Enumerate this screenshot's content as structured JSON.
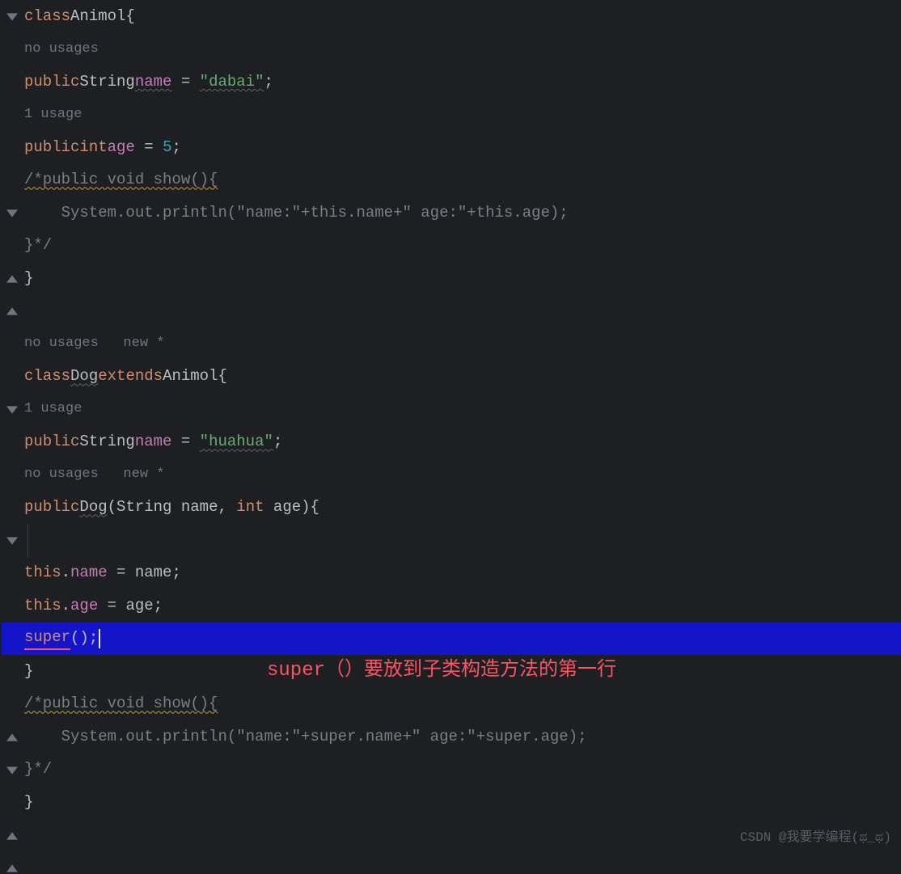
{
  "hints": {
    "no_usages": "no usages",
    "one_usage": "1 usage",
    "new": "new *",
    "no_usages_new": "no usages   new *"
  },
  "code": {
    "l1_class": "class",
    "l1_name": "Animol",
    "l1_brace": "{",
    "l3_public": "public",
    "l3_type": "String",
    "l3_field": "name",
    "l3_eq": " = ",
    "l3_str": "\"dabai\"",
    "l3_semi": ";",
    "l5_public": "public",
    "l5_type": "int",
    "l5_field": "age",
    "l5_eq": " = ",
    "l5_num": "5",
    "l5_semi": ";",
    "l6_comment": "/*public void show(){",
    "l7_comment": "    System.out.println(\"name:\"+this.name+\" age:\"+this.age);",
    "l8_comment": "}*/",
    "l9_brace": "}",
    "l12_class": "class",
    "l12_name": "Dog",
    "l12_extends": "extends",
    "l12_parent": "Animol",
    "l12_brace": "{",
    "l14_public": "public",
    "l14_type": "String",
    "l14_field": "name",
    "l14_eq": " = ",
    "l14_str": "\"huahua\"",
    "l14_semi": ";",
    "l16_public": "public",
    "l16_ctor": "Dog",
    "l16_p1t": "String",
    "l16_p1n": " name",
    "l16_comma": ", ",
    "l16_p2t": "int",
    "l16_p2n": " age",
    "l16_brace": "){",
    "l18_this": "this",
    "l18_dot": ".",
    "l18_field": "name",
    "l18_eq": " = name;",
    "l19_this": "this",
    "l19_dot": ".",
    "l19_field": "age",
    "l19_eq": " = age;",
    "l20_super": "super",
    "l20_call": "();",
    "l21_brace": "}",
    "l22_comment": "/*public void show(){",
    "l23_comment": "    System.out.println(\"name:\"+super.name+\" age:\"+super.age);",
    "l24_comment": "}*/",
    "l25_brace": "}"
  },
  "annotation": "super（）要放到子类构造方法的第一行",
  "watermark": "CSDN @我要学编程(ಥ_ಥ)"
}
